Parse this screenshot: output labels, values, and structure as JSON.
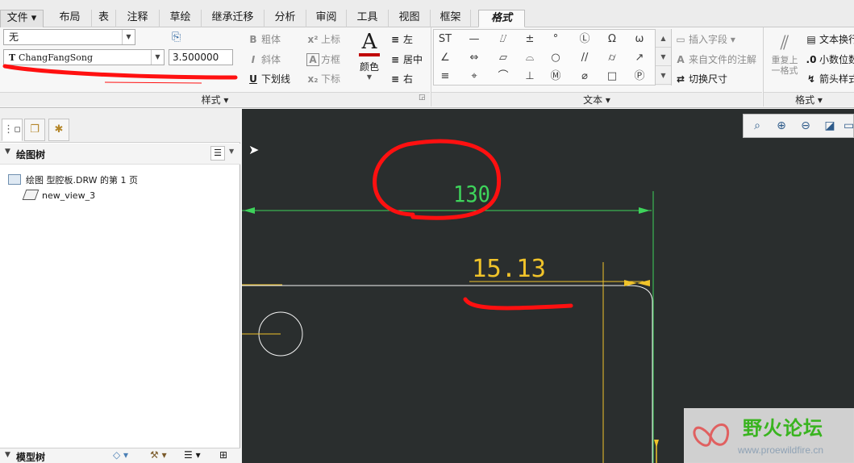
{
  "tabs": {
    "file": "文件",
    "items": [
      "布局",
      "表",
      "注释",
      "草绘",
      "继承迁移",
      "分析",
      "审阅",
      "工具",
      "视图",
      "框架",
      "格式"
    ]
  },
  "ribbon": {
    "style_group": {
      "style_select": "无",
      "font_select": "ChangFangSong",
      "height_value": "3.500000",
      "bold": "粗体",
      "italic": "斜体",
      "underline": "下划线",
      "superscript": "上标",
      "box": "方框",
      "subscript": "下标",
      "color": "颜色",
      "align_left": "左",
      "align_center": "居中",
      "align_right": "右",
      "label": "样式"
    },
    "text_group": {
      "symbols": [
        "ST",
        "—",
        "⌰",
        "±",
        "°",
        "Ⓛ",
        "Ω",
        "ω",
        "∠",
        "⇔",
        "▱",
        "⌓",
        "○",
        "//",
        "⌭",
        "↗",
        "≡",
        "⌖",
        "⌒",
        "⊥",
        "Ⓜ",
        "⌀",
        "□",
        "Ⓟ"
      ],
      "insert_field": "插入字段",
      "note_from_file": "来自文件的注解",
      "toggle_dimension": "切换尺寸",
      "label": "文本"
    },
    "format_group": {
      "reapply": "重复上一格式",
      "text_wrap": "文本换行",
      "decimal": "小数位数",
      "arrow_style": "箭头样式",
      "label": "格式"
    }
  },
  "left_panel": {
    "tree_title": "绘图树",
    "tree_items": [
      "绘图 型腔板.DRW 的第 1 页",
      "new_view_3"
    ],
    "model_tree_title": "模型树"
  },
  "canvas": {
    "dimension_top": "130",
    "dimension_bottom": "15.13"
  },
  "colors": {
    "canvas_bg": "#2a2e2e",
    "dim_green": "#3ed35b",
    "dim_yellow": "#f0c32a",
    "markup_red": "#ff1010"
  },
  "watermark": {
    "title": "野火论坛",
    "url": "www.proewildfire.cn"
  }
}
